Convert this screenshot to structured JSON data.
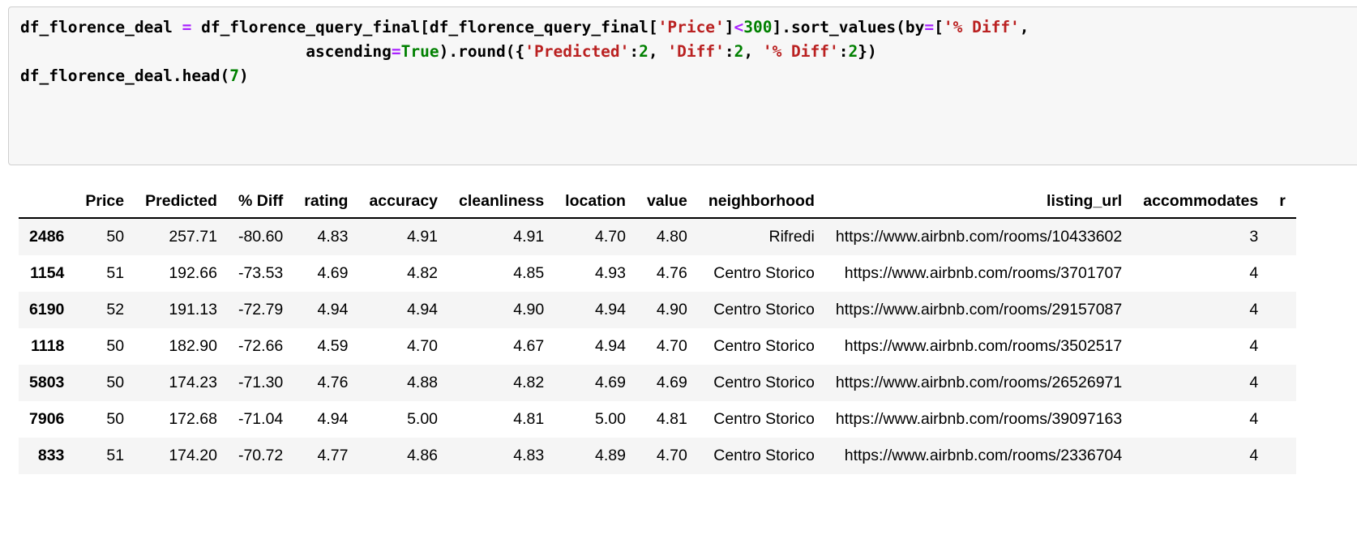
{
  "code_cell": {
    "language": "python",
    "lines": [
      [
        {
          "t": "df_florence_deal ",
          "c": "plain"
        },
        {
          "t": "=",
          "c": "op"
        },
        {
          "t": " df_florence_query_final[df_florence_query_final[",
          "c": "plain"
        },
        {
          "t": "'Price'",
          "c": "str"
        },
        {
          "t": "]",
          "c": "plain"
        },
        {
          "t": "<",
          "c": "op"
        },
        {
          "t": "300",
          "c": "num"
        },
        {
          "t": "].sort_values(by",
          "c": "plain"
        },
        {
          "t": "=",
          "c": "op"
        },
        {
          "t": "[",
          "c": "plain"
        },
        {
          "t": "'% Diff'",
          "c": "str"
        },
        {
          "t": ",",
          "c": "plain"
        }
      ],
      [
        {
          "t": "                              ascending",
          "c": "plain"
        },
        {
          "t": "=",
          "c": "op"
        },
        {
          "t": "True",
          "c": "kw"
        },
        {
          "t": ").round({",
          "c": "plain"
        },
        {
          "t": "'Predicted'",
          "c": "str"
        },
        {
          "t": ":",
          "c": "plain"
        },
        {
          "t": "2",
          "c": "num"
        },
        {
          "t": ", ",
          "c": "plain"
        },
        {
          "t": "'Diff'",
          "c": "str"
        },
        {
          "t": ":",
          "c": "plain"
        },
        {
          "t": "2",
          "c": "num"
        },
        {
          "t": ", ",
          "c": "plain"
        },
        {
          "t": "'% Diff'",
          "c": "str"
        },
        {
          "t": ":",
          "c": "plain"
        },
        {
          "t": "2",
          "c": "num"
        },
        {
          "t": "})",
          "c": "plain"
        }
      ],
      [
        {
          "t": "df_florence_deal.head(",
          "c": "plain"
        },
        {
          "t": "7",
          "c": "num"
        },
        {
          "t": ")",
          "c": "plain"
        }
      ]
    ]
  },
  "table": {
    "index_header": "",
    "columns": [
      "Price",
      "Predicted",
      "% Diff",
      "rating",
      "accuracy",
      "cleanliness",
      "location",
      "value",
      "neighborhood",
      "listing_url",
      "accommodates"
    ],
    "truncated_column_hint": "r",
    "rows": [
      {
        "index": "2486",
        "cells": [
          "50",
          "257.71",
          "-80.60",
          "4.83",
          "4.91",
          "4.91",
          "4.70",
          "4.80",
          "Rifredi",
          "https://www.airbnb.com/rooms/10433602",
          "3"
        ]
      },
      {
        "index": "1154",
        "cells": [
          "51",
          "192.66",
          "-73.53",
          "4.69",
          "4.82",
          "4.85",
          "4.93",
          "4.76",
          "Centro Storico",
          "https://www.airbnb.com/rooms/3701707",
          "4"
        ]
      },
      {
        "index": "6190",
        "cells": [
          "52",
          "191.13",
          "-72.79",
          "4.94",
          "4.94",
          "4.90",
          "4.94",
          "4.90",
          "Centro Storico",
          "https://www.airbnb.com/rooms/29157087",
          "4"
        ]
      },
      {
        "index": "1118",
        "cells": [
          "50",
          "182.90",
          "-72.66",
          "4.59",
          "4.70",
          "4.67",
          "4.94",
          "4.70",
          "Centro Storico",
          "https://www.airbnb.com/rooms/3502517",
          "4"
        ]
      },
      {
        "index": "5803",
        "cells": [
          "50",
          "174.23",
          "-71.30",
          "4.76",
          "4.88",
          "4.82",
          "4.69",
          "4.69",
          "Centro Storico",
          "https://www.airbnb.com/rooms/26526971",
          "4"
        ]
      },
      {
        "index": "7906",
        "cells": [
          "50",
          "172.68",
          "-71.04",
          "4.94",
          "5.00",
          "4.81",
          "5.00",
          "4.81",
          "Centro Storico",
          "https://www.airbnb.com/rooms/39097163",
          "4"
        ]
      },
      {
        "index": "833",
        "cells": [
          "51",
          "174.20",
          "-70.72",
          "4.77",
          "4.86",
          "4.83",
          "4.89",
          "4.70",
          "Centro Storico",
          "https://www.airbnb.com/rooms/2336704",
          "4"
        ]
      }
    ]
  },
  "colors": {
    "code_bg": "#f7f7f7",
    "code_border": "#cfcfcf",
    "string_token": "#ba2121",
    "number_token": "#008000",
    "operator_token": "#aa22ff",
    "keyword_token": "#008000",
    "row_stripe": "#f5f5f5",
    "page_bg": "#ffffff"
  }
}
